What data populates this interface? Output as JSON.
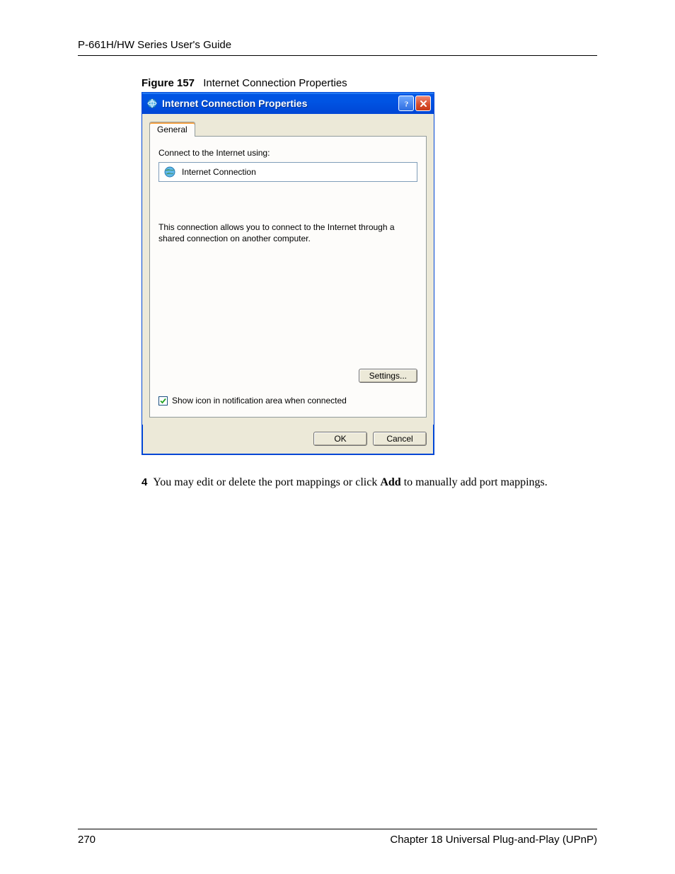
{
  "header": {
    "guide_title": "P-661H/HW Series User's Guide"
  },
  "figure": {
    "label": "Figure 157",
    "caption": "Internet Connection Properties"
  },
  "dialog": {
    "title": "Internet Connection Properties",
    "tab_general": "General",
    "connect_label": "Connect to the Internet using:",
    "connection_name": "Internet Connection",
    "description": "This connection allows you to connect to the Internet through a shared connection on another computer.",
    "settings_button": "Settings...",
    "checkbox_label": "Show icon in notification area when connected",
    "ok_button": "OK",
    "cancel_button": "Cancel"
  },
  "step": {
    "number": "4",
    "text_before": "You may edit or delete the port mappings or click ",
    "text_bold": "Add",
    "text_after": " to manually add port mappings."
  },
  "footer": {
    "page_number": "270",
    "chapter": "Chapter 18 Universal Plug-and-Play (UPnP)"
  }
}
